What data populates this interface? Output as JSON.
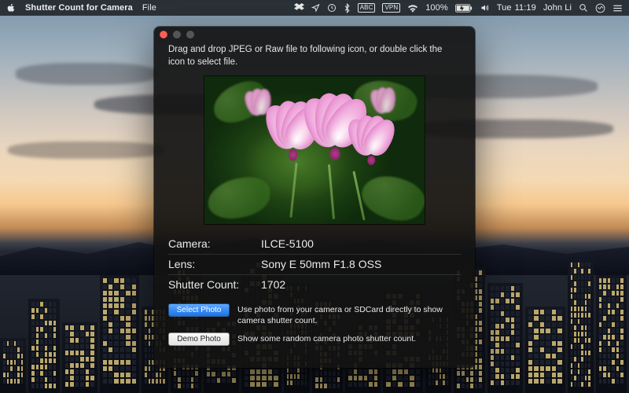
{
  "menubar": {
    "app_name": "Shutter Count for Camera",
    "menus": [
      "File"
    ],
    "status": {
      "input_source": "ABC",
      "vpn": "VPN",
      "battery_percent": "100%",
      "day": "Tue",
      "time": "11:19",
      "user": "John Li"
    }
  },
  "window": {
    "hint": "Drag and drop JPEG or Raw file to following icon, or double click the icon to select file.",
    "fields": {
      "camera_label": "Camera:",
      "camera_value": "ILCE-5100",
      "lens_label": "Lens:",
      "lens_value": "Sony E 50mm F1.8 OSS",
      "shutter_label": "Shutter Count:",
      "shutter_value": "1702"
    },
    "actions": {
      "select_label": "Select Photo",
      "select_desc": "Use photo from your camera or SDCard directly to show camera shutter count.",
      "demo_label": "Demo Photo",
      "demo_desc": "Show some random camera photo shutter count."
    }
  }
}
